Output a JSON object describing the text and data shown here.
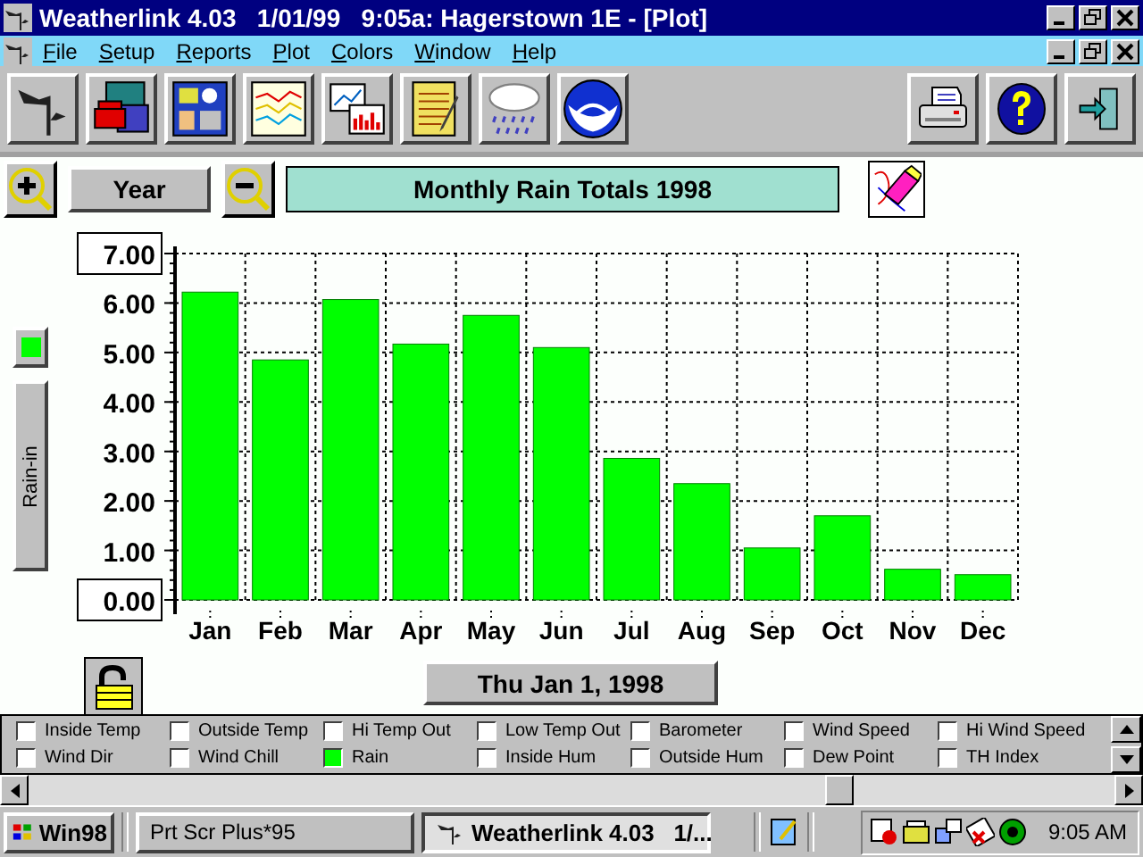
{
  "window": {
    "title": "Weatherlink 4.03   1/01/99   9:05a: Hagerstown 1E - [Plot]"
  },
  "menu": [
    "File",
    "Setup",
    "Reports",
    "Plot",
    "Colors",
    "Window",
    "Help"
  ],
  "period_button": "Year",
  "plot_title": "Monthly Rain Totals 1998",
  "chart_data": {
    "type": "bar",
    "grid": true,
    "categories": [
      "Jan",
      "Feb",
      "Mar",
      "Apr",
      "May",
      "Jun",
      "Jul",
      "Aug",
      "Sep",
      "Oct",
      "Nov",
      "Dec"
    ],
    "series": [
      {
        "name": "Rain-in",
        "color": "#00ff00",
        "values": [
          6.22,
          4.85,
          6.07,
          5.17,
          5.75,
          5.1,
          2.86,
          2.35,
          1.05,
          1.7,
          0.62,
          0.51
        ]
      }
    ],
    "ylim": [
      0,
      7
    ],
    "yticks": [
      {
        "value": 0,
        "label": "0.00"
      },
      {
        "value": 1,
        "label": "1.00"
      },
      {
        "value": 2,
        "label": "2.00"
      },
      {
        "value": 3,
        "label": "3.00"
      },
      {
        "value": 4,
        "label": "4.00"
      },
      {
        "value": 5,
        "label": "5.00"
      },
      {
        "value": 6,
        "label": "6.00"
      },
      {
        "value": 7,
        "label": "7.00"
      }
    ]
  },
  "date_button": "Thu Jan 1, 1998",
  "sensors": [
    {
      "label": "Inside Temp",
      "checked": false
    },
    {
      "label": "Outside Temp",
      "checked": false
    },
    {
      "label": "Hi Temp Out",
      "checked": false
    },
    {
      "label": "Low Temp Out",
      "checked": false
    },
    {
      "label": "Barometer",
      "checked": false
    },
    {
      "label": "Wind Speed",
      "checked": false
    },
    {
      "label": "Hi Wind Speed",
      "checked": false
    },
    {
      "label": "Wind Dir",
      "checked": false
    },
    {
      "label": "Wind Chill",
      "checked": false
    },
    {
      "label": "Rain",
      "checked": true
    },
    {
      "label": "Inside Hum",
      "checked": false
    },
    {
      "label": "Outside Hum",
      "checked": false
    },
    {
      "label": "Dew Point",
      "checked": false
    },
    {
      "label": "TH Index",
      "checked": false
    }
  ],
  "taskbar": {
    "start": "Win98",
    "tasks": [
      {
        "label": "Prt Scr Plus*95",
        "selected": false
      },
      {
        "label": "Weatherlink 4.03   1/...",
        "selected": true
      }
    ],
    "clock": "9:05 AM"
  }
}
